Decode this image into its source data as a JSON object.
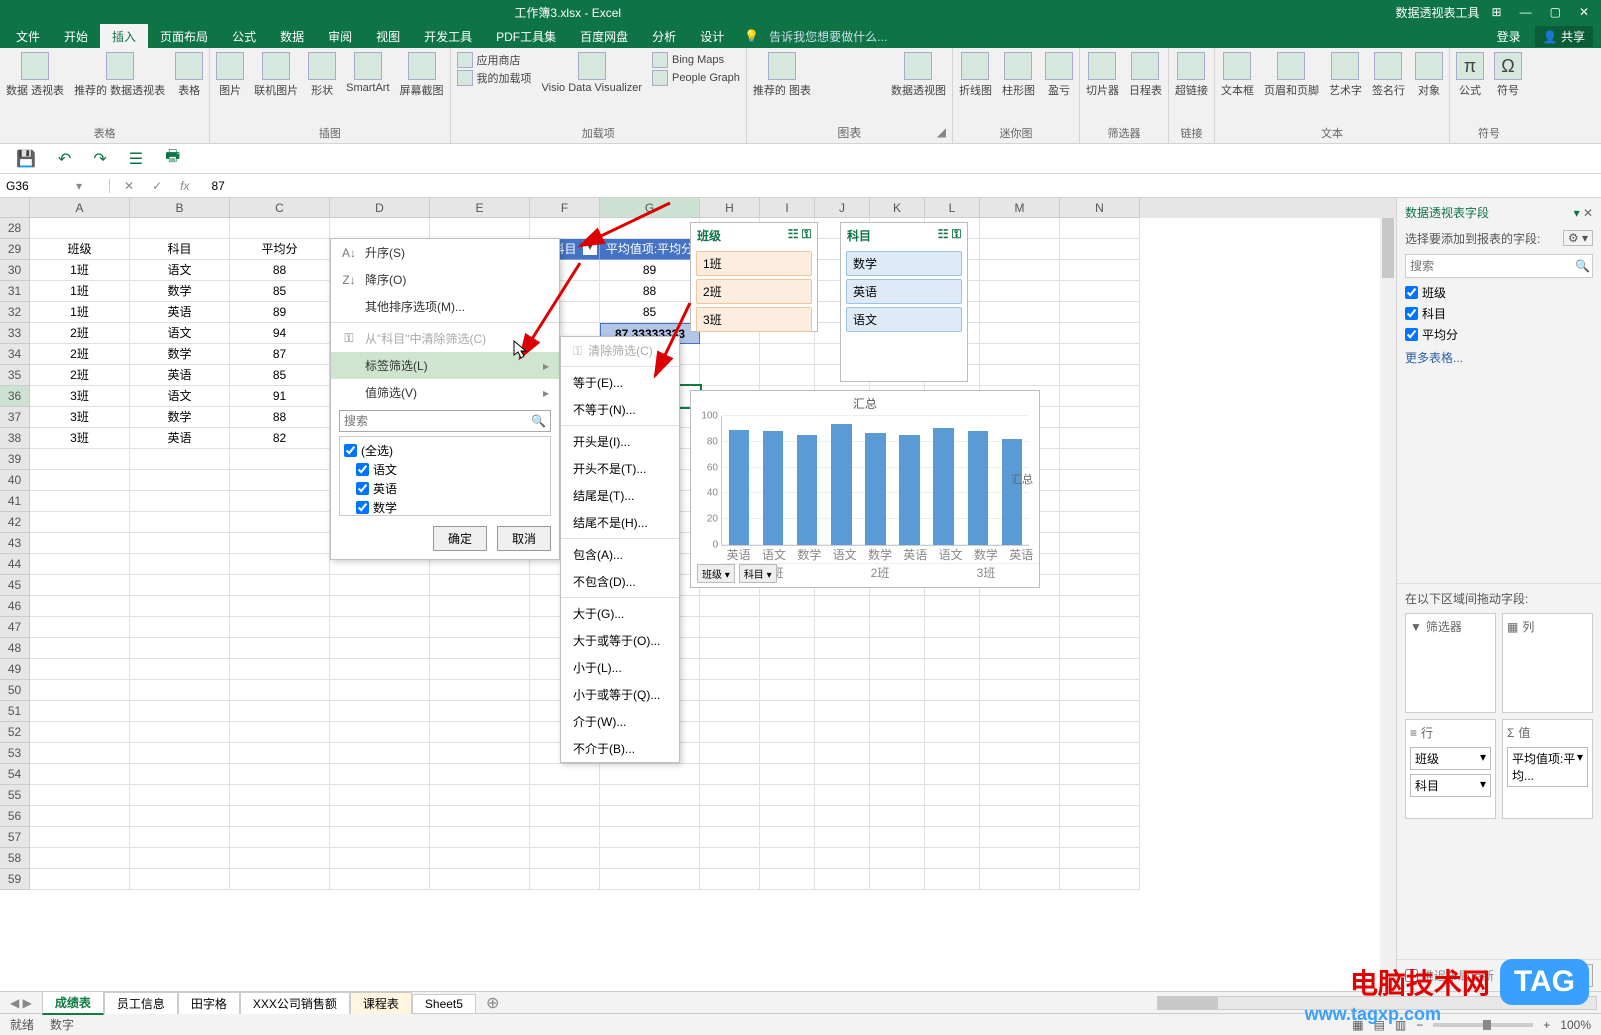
{
  "title": {
    "app_caption": "工作簿3.xlsx - Excel",
    "pt_tools": "数据透视表工具"
  },
  "win_btns": {
    "min": "—",
    "max": "▢",
    "close": "✕",
    "ribbon_opts": "⊞"
  },
  "tabs": {
    "file": "文件",
    "home": "开始",
    "insert": "插入",
    "layout": "页面布局",
    "formulas": "公式",
    "data": "数据",
    "review": "审阅",
    "view": "视图",
    "dev": "开发工具",
    "pdf": "PDF工具集",
    "baidu": "百度网盘",
    "analyze": "分析",
    "design": "设计",
    "tellme": "告诉我您想要做什么...",
    "login": "登录",
    "share": "共享"
  },
  "ribbon": {
    "tables": {
      "pivot": "数据\n透视表",
      "recpivot": "推荐的\n数据透视表",
      "table": "表格",
      "group": "表格"
    },
    "illus": {
      "pic": "图片",
      "online": "联机图片",
      "shapes": "形状",
      "smartart": "SmartArt",
      "screenshot": "屏幕截图",
      "group": "插图"
    },
    "addins": {
      "store": "应用商店",
      "myaddins": "我的加载项",
      "visio": "Visio Data\nVisualizer",
      "bing": "Bing Maps",
      "people": "People Graph",
      "group": "加载项"
    },
    "charts": {
      "rec": "推荐的\n图表",
      "pivotchart": "数据透视图",
      "group": "图表"
    },
    "spark": {
      "line": "折线图",
      "column": "柱形图",
      "winloss": "盈亏",
      "group": "迷你图"
    },
    "filter": {
      "slicer": "切片器",
      "timeline": "日程表",
      "group": "筛选器"
    },
    "link": {
      "hyperlink": "超链接",
      "group": "链接"
    },
    "text": {
      "textbox": "文本框",
      "hf": "页眉和页脚",
      "wordart": "艺术字",
      "sig": "签名行",
      "obj": "对象",
      "group": "文本"
    },
    "symbol": {
      "eq": "公式",
      "sym": "符号",
      "group": "符号"
    }
  },
  "qat": {
    "save": "💾",
    "undo": "↶",
    "redo": "↷",
    "touch": "☰",
    "print": "🖶"
  },
  "fbar": {
    "namebox": "G36",
    "fx": "fx",
    "x": "✕",
    "check": "✓",
    "formula": "87"
  },
  "columns": [
    "A",
    "B",
    "C",
    "D",
    "E",
    "F",
    "G",
    "H",
    "I",
    "J",
    "K",
    "L",
    "M",
    "N"
  ],
  "rows_start": 28,
  "sheet": {
    "headers": {
      "class": "班级",
      "subject": "科目",
      "avg": "平均分"
    },
    "data": [
      {
        "class": "1班",
        "subject": "语文",
        "avg": "88"
      },
      {
        "class": "1班",
        "subject": "数学",
        "avg": "85"
      },
      {
        "class": "1班",
        "subject": "英语",
        "avg": "89"
      },
      {
        "class": "2班",
        "subject": "语文",
        "avg": "94"
      },
      {
        "class": "2班",
        "subject": "数学",
        "avg": "87"
      },
      {
        "class": "2班",
        "subject": "英语",
        "avg": "85"
      },
      {
        "class": "3班",
        "subject": "语文",
        "avg": "91"
      },
      {
        "class": "3班",
        "subject": "数学",
        "avg": "88"
      },
      {
        "class": "3班",
        "subject": "英语",
        "avg": "82"
      }
    ]
  },
  "pivot": {
    "col_class": "班级",
    "col_subject": "科目",
    "col_value": "平均值项:平均分",
    "values": [
      "89",
      "88",
      "85",
      "87.33333333"
    ]
  },
  "slicer1": {
    "title": "班级",
    "items": [
      "1班",
      "2班",
      "3班"
    ]
  },
  "slicer2": {
    "title": "科目",
    "items": [
      "数学",
      "英语",
      "语文"
    ]
  },
  "fmenu": {
    "sort_asc": "升序(S)",
    "sort_desc": "降序(O)",
    "more_sort": "其他排序选项(M)...",
    "clear_filter": "从\"科目\"中清除筛选(C)",
    "label_filter": "标签筛选(L)",
    "value_filter": "值筛选(V)",
    "search_ph": "搜索",
    "all": "(全选)",
    "chk1": "语文",
    "chk2": "英语",
    "chk3": "数学",
    "ok": "确定",
    "cancel": "取消"
  },
  "submenu": {
    "clear": "清除筛选(C)",
    "eq": "等于(E)...",
    "neq": "不等于(N)...",
    "begins": "开头是(I)...",
    "nbegins": "开头不是(T)...",
    "ends": "结尾是(T)...",
    "nends": "结尾不是(H)...",
    "contains": "包含(A)...",
    "ncontains": "不包含(D)...",
    "gt": "大于(G)...",
    "gte": "大于或等于(O)...",
    "lt": "小于(L)...",
    "lte": "小于或等于(Q)...",
    "between": "介于(W)...",
    "nbetween": "不介于(B)..."
  },
  "chart_data": {
    "type": "bar",
    "title": "汇总",
    "ylim": [
      0,
      100
    ],
    "yticks": [
      0,
      20,
      40,
      60,
      80,
      100
    ],
    "legend": "汇总",
    "groups": [
      "1班",
      "2班",
      "3班"
    ],
    "categories": [
      "英语",
      "语文",
      "数学",
      "语文",
      "数学",
      "英语",
      "语文",
      "数学",
      "英语"
    ],
    "values": [
      89,
      88,
      85,
      94,
      87,
      85,
      91,
      88,
      82
    ],
    "pivot_buttons": [
      "班级 ▾",
      "科目 ▾"
    ]
  },
  "panel": {
    "title": "数据透视表字段",
    "sub": "选择要添加到报表的字段:",
    "search_ph": "搜索",
    "fields": [
      "班级",
      "科目",
      "平均分"
    ],
    "more": "更多表格...",
    "areas_label": "在以下区域间拖动字段:",
    "filters": "筛选器",
    "columns": "列",
    "rows": "行",
    "values": "值",
    "row_items": [
      "班级",
      "科目"
    ],
    "value_items": [
      "平均值项:平均..."
    ],
    "defer": "推迟布局更新",
    "update": "更新"
  },
  "sheets": {
    "s1": "成绩表",
    "s2": "员工信息",
    "s3": "田字格",
    "s4": "XXX公司销售额",
    "s5": "课程表",
    "s6": "Sheet5"
  },
  "status": {
    "ready": "就绪",
    "mode": "数字",
    "zoom": "100%"
  },
  "watermark": {
    "txt": "电脑技术网",
    "tag": "TAG",
    "url": "www.tagxp.com"
  }
}
